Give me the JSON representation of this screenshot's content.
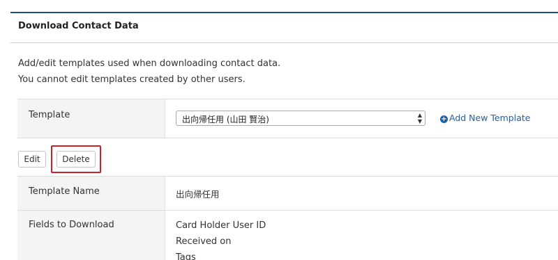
{
  "section": {
    "title": "Download Contact Data",
    "description_line1": "Add/edit templates used when downloading contact data.",
    "description_line2": "You cannot edit templates created by other users."
  },
  "template_selector": {
    "label": "Template",
    "selected_value": "出向帰任用 (山田 賢治)",
    "add_link_label": "Add New Template",
    "add_icon": "plus-circle-icon"
  },
  "actions": {
    "edit_label": "Edit",
    "delete_label": "Delete",
    "highlight_color": "#cc1f26"
  },
  "details": {
    "template_name_label": "Template Name",
    "template_name_value": "出向帰任用",
    "fields_label": "Fields to Download",
    "fields": [
      "Card Holder User ID",
      "Received on",
      "Tags"
    ]
  },
  "colors": {
    "accent_border": "#1f4e79",
    "link": "#1f5fa8",
    "label_background": "#f4f4f4"
  }
}
